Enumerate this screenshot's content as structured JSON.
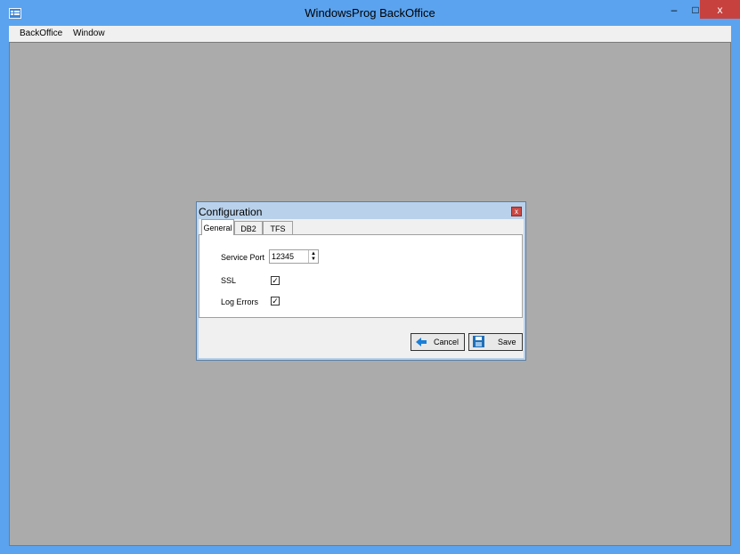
{
  "window": {
    "title": "WindowsProg BackOffice",
    "controls": {
      "minimize": "–",
      "maximize": "□",
      "close": "x"
    }
  },
  "menu": [
    "BackOffice",
    "Window"
  ],
  "dialog": {
    "title": "Configuration",
    "close": "x",
    "tabs": [
      "General",
      "DB2",
      "TFS"
    ],
    "active_tab": "General",
    "fields": {
      "service_port_label": "Service Port",
      "service_port_value": "12345",
      "ssl_label": "SSL",
      "ssl_checked": true,
      "log_errors_label": "Log Errors",
      "log_errors_checked": true
    },
    "buttons": {
      "cancel": "Cancel",
      "save": "Save"
    },
    "check_mark": "✓"
  },
  "colors": {
    "frame": "#5ba3ee",
    "mdi_background": "#ababab",
    "close_red": "#c7413f",
    "cancel_icon": "#1a7fd8",
    "save_icon": "#1f6fb8"
  }
}
